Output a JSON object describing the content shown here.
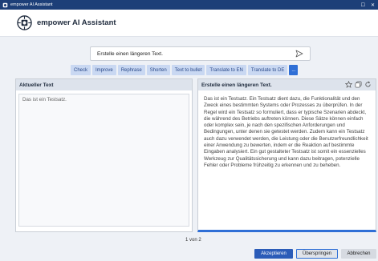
{
  "window": {
    "title": "empower AI Assistant"
  },
  "header": {
    "title": "empower AI Assistant"
  },
  "prompt": {
    "value": "Erstelle einen längeren Text."
  },
  "quick_actions": [
    "Check",
    "Improve",
    "Rephrase",
    "Shorten",
    "Text to bullet",
    "Translate to EN",
    "Translate to DE",
    "..."
  ],
  "left_panel": {
    "title": "Aktueller Text",
    "text": "Das ist ein Testsatz."
  },
  "right_panel": {
    "title": "Erstelle einen längeren Text.",
    "text": "Das ist ein Testsatz. Ein Testsatz dient dazu, die Funktionalität und den Zweck eines bestimmten Systems oder Prozesses zu überprüfen. In der Regel wird ein Testsatz so formuliert, dass er typische Szenarien abdeckt, die während des Betriebs auftreten können. Diese Sätze können einfach oder komplex sein, je nach den spezifischen Anforderungen und Bedingungen, unter denen sie getestet werden. Zudem kann ein Testsatz auch dazu verwendet werden, die Leistung oder die Benutzerfreundlichkeit einer Anwendung zu bewerten, indem er die Reaktion auf bestimmte Eingaben analysiert. Ein gut gestalteter Testsatz ist somit ein essenzielles Werkzeug zur Qualitätssicherung und kann dazu beitragen, potenzielle Fehler oder Probleme frühzeitig zu erkennen und zu beheben."
  },
  "pager": {
    "text": "1 von 2"
  },
  "footer": {
    "accept": "Akzeptieren",
    "skip": "Überspringen",
    "cancel": "Abbrechen"
  },
  "colors": {
    "titlebar": "#1d3f78",
    "accent": "#2f6fd6",
    "quick_action_bg": "#c9d8f2"
  }
}
